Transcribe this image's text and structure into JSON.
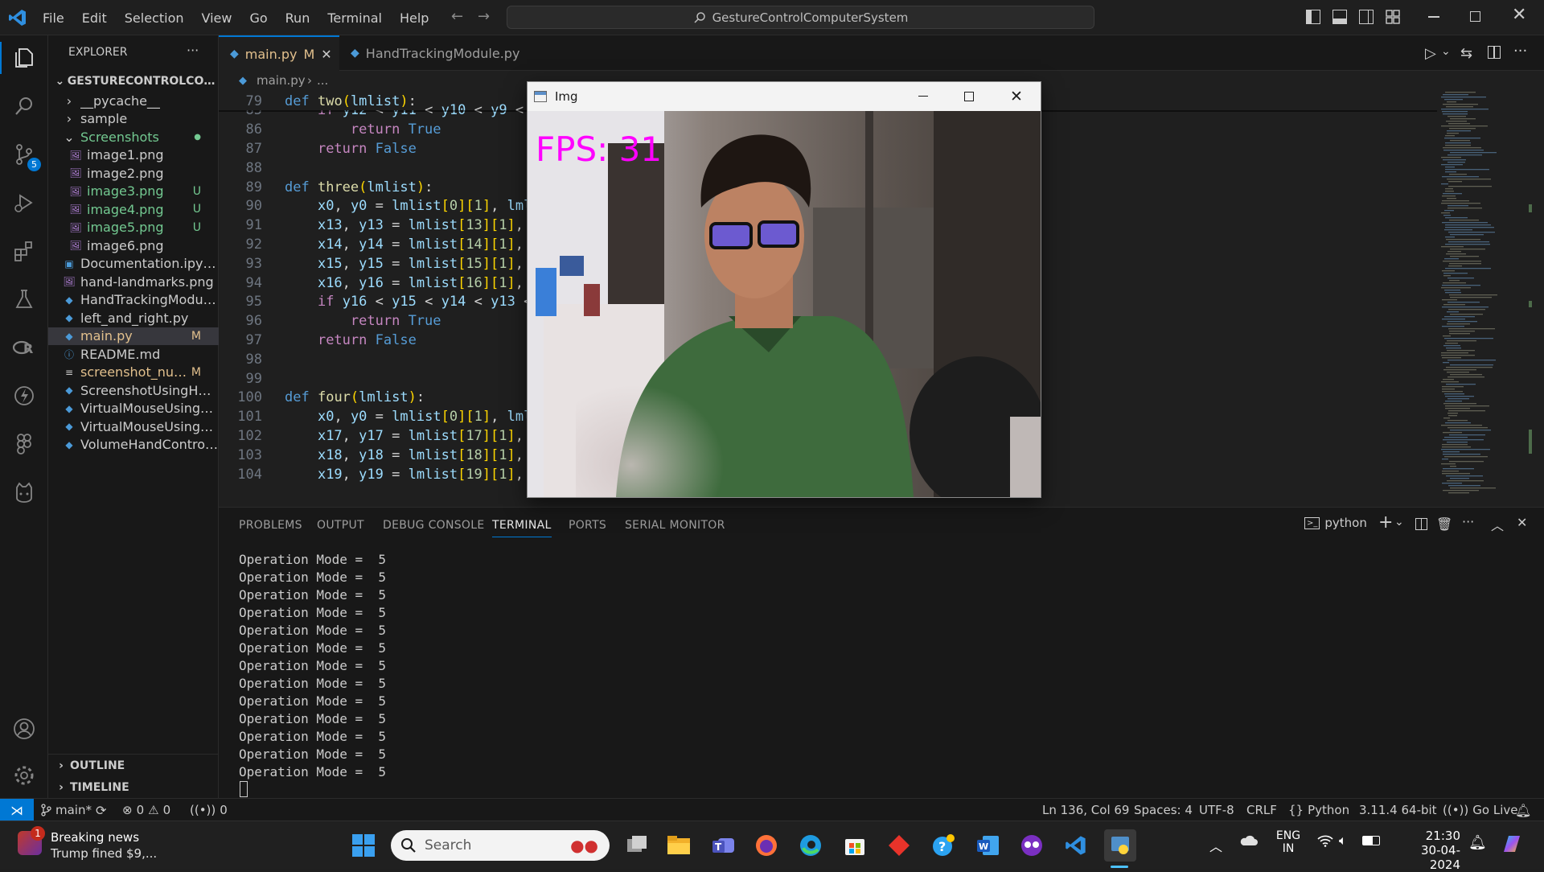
{
  "titlebar": {
    "menu": [
      "File",
      "Edit",
      "Selection",
      "View",
      "Go",
      "Run",
      "Terminal",
      "Help"
    ],
    "search_text": "GestureControlComputerSystem"
  },
  "activity": {
    "scm_badge": "5"
  },
  "explorer": {
    "title": "EXPLORER",
    "more": "···",
    "root": "GESTURECONTROLCOMPU...",
    "items": [
      {
        "label": "__pycache__",
        "kind": "folder",
        "indent": 1,
        "open": false,
        "color": "#cccccc",
        "badge": ""
      },
      {
        "label": "sample",
        "kind": "folder",
        "indent": 1,
        "open": false,
        "color": "#cccccc",
        "badge": ""
      },
      {
        "label": "Screenshots",
        "kind": "folder",
        "indent": 1,
        "open": true,
        "color": "#73c991",
        "badge": "●"
      },
      {
        "label": "image1.png",
        "kind": "image",
        "indent": 2,
        "color": "#cccccc",
        "badge": ""
      },
      {
        "label": "image2.png",
        "kind": "image",
        "indent": 2,
        "color": "#cccccc",
        "badge": ""
      },
      {
        "label": "image3.png",
        "kind": "image",
        "indent": 2,
        "color": "#73c991",
        "badge": "U"
      },
      {
        "label": "image4.png",
        "kind": "image",
        "indent": 2,
        "color": "#73c991",
        "badge": "U"
      },
      {
        "label": "image5.png",
        "kind": "image",
        "indent": 2,
        "color": "#73c991",
        "badge": "U"
      },
      {
        "label": "image6.png",
        "kind": "image",
        "indent": 2,
        "color": "#cccccc",
        "badge": ""
      },
      {
        "label": "Documentation.ipynb",
        "kind": "notebook",
        "indent": 1,
        "color": "#cccccc",
        "badge": ""
      },
      {
        "label": "hand-landmarks.png",
        "kind": "image",
        "indent": 1,
        "color": "#cccccc",
        "badge": ""
      },
      {
        "label": "HandTrackingModule....",
        "kind": "python",
        "indent": 1,
        "color": "#cccccc",
        "badge": ""
      },
      {
        "label": "left_and_right.py",
        "kind": "python",
        "indent": 1,
        "color": "#cccccc",
        "badge": ""
      },
      {
        "label": "main.py",
        "kind": "python",
        "indent": 1,
        "color": "#e2c08d",
        "badge": "M",
        "selected": true
      },
      {
        "label": "README.md",
        "kind": "info",
        "indent": 1,
        "color": "#cccccc",
        "badge": ""
      },
      {
        "label": "screenshot_num...",
        "kind": "text",
        "indent": 1,
        "color": "#e2c08d",
        "badge": "M"
      },
      {
        "label": "ScreenshotUsingHan...",
        "kind": "python",
        "indent": 1,
        "color": "#cccccc",
        "badge": ""
      },
      {
        "label": "VirtualMouseUsingYo...",
        "kind": "python",
        "indent": 1,
        "color": "#cccccc",
        "badge": ""
      },
      {
        "label": "VirtualMouseUsingYo...",
        "kind": "python",
        "indent": 1,
        "color": "#cccccc",
        "badge": ""
      },
      {
        "label": "VolumeHandControl.py",
        "kind": "python",
        "indent": 1,
        "color": "#cccccc",
        "badge": ""
      }
    ],
    "outline": "OUTLINE",
    "timeline": "TIMELINE"
  },
  "tabs": [
    {
      "label": "main.py",
      "modified": "M",
      "active": true
    },
    {
      "label": "HandTrackingModule.py",
      "modified": "",
      "active": false
    }
  ],
  "breadcrumb": {
    "file": "main.py",
    "rest": "..."
  },
  "code": [
    {
      "n": "79",
      "html": "<span class='kw'>def</span> <span class='fn'>two</span><span class='bk'>(</span><span class='vr'>lmlist</span><span class='bk'>)</span><span class='tx'>:</span>"
    },
    {
      "n": "85",
      "html": "    <span class='cf'>if</span> <span class='vr'>y12</span> <span class='tx'>&lt;</span> <span class='vr'>y11</span> <span class='tx'>&lt;</span> <span class='vr'>y10</span> <span class='tx'>&lt;</span> <span class='vr'>y9</span> <span class='tx'>&lt;</span> <span class='vr'>y</span>"
    },
    {
      "n": "86",
      "html": "        <span class='cf'>return</span> <span class='kw'>True</span>"
    },
    {
      "n": "87",
      "html": "    <span class='cf'>return</span> <span class='kw'>False</span>"
    },
    {
      "n": "88",
      "html": ""
    },
    {
      "n": "89",
      "html": "<span class='kw'>def</span> <span class='fn'>three</span><span class='bk'>(</span><span class='vr'>lmlist</span><span class='bk'>)</span><span class='tx'>:</span>"
    },
    {
      "n": "90",
      "html": "    <span class='vr'>x0</span><span class='tx'>,</span> <span class='vr'>y0</span> <span class='tx'>=</span> <span class='vr'>lmlist</span><span class='bk'>[</span><span class='nb'>0</span><span class='bk'>]</span><span class='bk'>[</span><span class='nb'>1</span><span class='bk'>]</span><span class='tx'>,</span> <span class='vr'>lmli</span>"
    },
    {
      "n": "91",
      "html": "    <span class='vr'>x13</span><span class='tx'>,</span> <span class='vr'>y13</span> <span class='tx'>=</span> <span class='vr'>lmlist</span><span class='bk'>[</span><span class='nb'>13</span><span class='bk'>]</span><span class='bk'>[</span><span class='nb'>1</span><span class='bk'>]</span><span class='tx'>,</span> <span class='vr'>l</span>"
    },
    {
      "n": "92",
      "html": "    <span class='vr'>x14</span><span class='tx'>,</span> <span class='vr'>y14</span> <span class='tx'>=</span> <span class='vr'>lmlist</span><span class='bk'>[</span><span class='nb'>14</span><span class='bk'>]</span><span class='bk'>[</span><span class='nb'>1</span><span class='bk'>]</span><span class='tx'>,</span> <span class='vr'>l</span>"
    },
    {
      "n": "93",
      "html": "    <span class='vr'>x15</span><span class='tx'>,</span> <span class='vr'>y15</span> <span class='tx'>=</span> <span class='vr'>lmlist</span><span class='bk'>[</span><span class='nb'>15</span><span class='bk'>]</span><span class='bk'>[</span><span class='nb'>1</span><span class='bk'>]</span><span class='tx'>,</span> <span class='vr'>l</span>"
    },
    {
      "n": "94",
      "html": "    <span class='vr'>x16</span><span class='tx'>,</span> <span class='vr'>y16</span> <span class='tx'>=</span> <span class='vr'>lmlist</span><span class='bk'>[</span><span class='nb'>16</span><span class='bk'>]</span><span class='bk'>[</span><span class='nb'>1</span><span class='bk'>]</span><span class='tx'>,</span> <span class='vr'>l</span>"
    },
    {
      "n": "95",
      "html": "    <span class='cf'>if</span> <span class='vr'>y16</span> <span class='tx'>&lt;</span> <span class='vr'>y15</span> <span class='tx'>&lt;</span> <span class='vr'>y14</span> <span class='tx'>&lt;</span> <span class='vr'>y13</span> <span class='tx'>&lt;</span>"
    },
    {
      "n": "96",
      "html": "        <span class='cf'>return</span> <span class='kw'>True</span>"
    },
    {
      "n": "97",
      "html": "    <span class='cf'>return</span> <span class='kw'>False</span>"
    },
    {
      "n": "98",
      "html": ""
    },
    {
      "n": "99",
      "html": ""
    },
    {
      "n": "100",
      "html": "<span class='kw'>def</span> <span class='fn'>four</span><span class='bk'>(</span><span class='vr'>lmlist</span><span class='bk'>)</span><span class='tx'>:</span>"
    },
    {
      "n": "101",
      "html": "    <span class='vr'>x0</span><span class='tx'>,</span> <span class='vr'>y0</span> <span class='tx'>=</span> <span class='vr'>lmlist</span><span class='bk'>[</span><span class='nb'>0</span><span class='bk'>]</span><span class='bk'>[</span><span class='nb'>1</span><span class='bk'>]</span><span class='tx'>,</span> <span class='vr'>lmli</span>"
    },
    {
      "n": "102",
      "html": "    <span class='vr'>x17</span><span class='tx'>,</span> <span class='vr'>y17</span> <span class='tx'>=</span> <span class='vr'>lmlist</span><span class='bk'>[</span><span class='nb'>17</span><span class='bk'>]</span><span class='bk'>[</span><span class='nb'>1</span><span class='bk'>]</span><span class='tx'>,</span> <span class='vr'>l</span>"
    },
    {
      "n": "103",
      "html": "    <span class='vr'>x18</span><span class='tx'>,</span> <span class='vr'>y18</span> <span class='tx'>=</span> <span class='vr'>lmlist</span><span class='bk'>[</span><span class='nb'>18</span><span class='bk'>]</span><span class='bk'>[</span><span class='nb'>1</span><span class='bk'>]</span><span class='tx'>,</span> <span class='vr'>l</span>"
    },
    {
      "n": "104",
      "html": "    <span class='vr'>x19</span><span class='tx'>,</span> <span class='vr'>y19</span> <span class='tx'>=</span> <span class='vr'>lmlist</span><span class='bk'>[</span><span class='nb'>19</span><span class='bk'>]</span><span class='bk'>[</span><span class='nb'>1</span><span class='bk'>]</span><span class='tx'>,</span> <span class='vr'>l</span>"
    }
  ],
  "panel": {
    "tabs": [
      "PROBLEMS",
      "OUTPUT",
      "DEBUG CONSOLE",
      "TERMINAL",
      "PORTS",
      "SERIAL MONITOR"
    ],
    "active_tab": "TERMINAL",
    "shell": "python",
    "terminal_lines": [
      "Operation Mode =  5",
      "Operation Mode =  5",
      "Operation Mode =  5",
      "Operation Mode =  5",
      "Operation Mode =  5",
      "Operation Mode =  5",
      "Operation Mode =  5",
      "Operation Mode =  5",
      "Operation Mode =  5",
      "Operation Mode =  5",
      "Operation Mode =  5",
      "Operation Mode =  5",
      "Operation Mode =  5"
    ]
  },
  "img_window": {
    "title": "Img",
    "fps_text": "FPS: 31"
  },
  "status": {
    "branch": "main*",
    "errors": "0",
    "warnings": "0",
    "ports": "0",
    "position": "Ln 136, Col 69",
    "spaces": "Spaces: 4",
    "encoding": "UTF-8",
    "eol": "CRLF",
    "language": "Python",
    "interpreter": "3.11.4 64-bit",
    "golive": "Go Live"
  },
  "taskbar": {
    "news_title": "Breaking news",
    "news_sub": "Trump fined $9,...",
    "news_badge": "1",
    "search_placeholder": "Search",
    "lang_top": "ENG",
    "lang_bottom": "IN",
    "time": "21:30",
    "date": "30-04-2024"
  },
  "colors": {
    "accent": "#0078d4",
    "fps": "#ff00ff",
    "modified": "#e2c08d",
    "untracked": "#73c991"
  }
}
